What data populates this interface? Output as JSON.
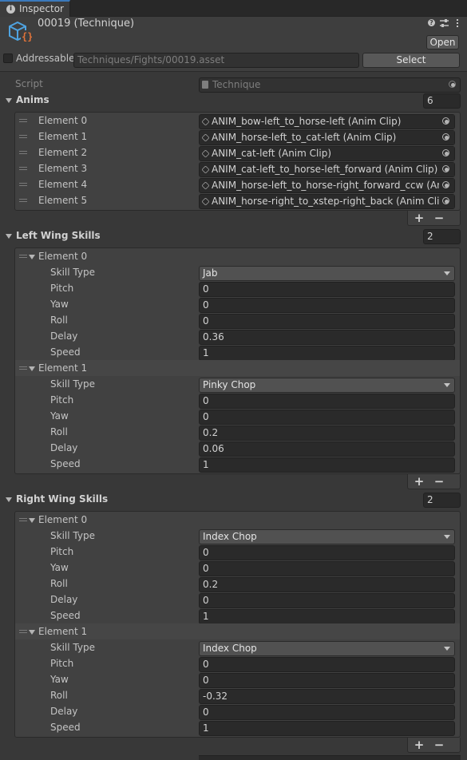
{
  "tab": {
    "label": "Inspector"
  },
  "header": {
    "title": "00019 (Technique)",
    "open_label": "Open",
    "addressable_label": "Addressable",
    "address_path": "Techniques/Fights/00019.asset",
    "select_label": "Select"
  },
  "script": {
    "label": "Script",
    "value": "Technique"
  },
  "anims": {
    "label": "Anims",
    "count": "6",
    "items": [
      {
        "label": "Element 0",
        "value": "ANIM_bow-left_to_horse-left (Anim Clip)"
      },
      {
        "label": "Element 1",
        "value": "ANIM_horse-left_to_cat-left (Anim Clip)"
      },
      {
        "label": "Element 2",
        "value": "ANIM_cat-left (Anim Clip)"
      },
      {
        "label": "Element 3",
        "value": "ANIM_cat-left_to_horse-left_forward (Anim Clip)"
      },
      {
        "label": "Element 4",
        "value": "ANIM_horse-left_to_horse-right_forward_ccw (Anim"
      },
      {
        "label": "Element 5",
        "value": "ANIM_horse-right_to_xstep-right_back (Anim Clip)"
      }
    ]
  },
  "field_labels": {
    "skill_type": "Skill Type",
    "pitch": "Pitch",
    "yaw": "Yaw",
    "roll": "Roll",
    "delay": "Delay",
    "speed": "Speed"
  },
  "left_wing": {
    "label": "Left Wing Skills",
    "count": "2",
    "elements": [
      {
        "label": "Element 0",
        "skill_type": "Jab",
        "pitch": "0",
        "yaw": "0",
        "roll": "0",
        "delay": "0.36",
        "speed": "1"
      },
      {
        "label": "Element 1",
        "skill_type": "Pinky Chop",
        "pitch": "0",
        "yaw": "0",
        "roll": "0.2",
        "delay": "0.06",
        "speed": "1"
      }
    ]
  },
  "right_wing": {
    "label": "Right Wing Skills",
    "count": "2",
    "elements": [
      {
        "label": "Element 0",
        "skill_type": "Index Chop",
        "pitch": "0",
        "yaw": "0",
        "roll": "0.2",
        "delay": "0",
        "speed": "1"
      },
      {
        "label": "Element 1",
        "skill_type": "Index Chop",
        "pitch": "0",
        "yaw": "0",
        "roll": "-0.32",
        "delay": "0",
        "speed": "1"
      }
    ]
  },
  "list_controls": {
    "add": "+",
    "remove": "−"
  },
  "colors": {
    "background": "#383838",
    "field": "#2a2a2a",
    "accent": "#3a79bb",
    "asset_icon": "#4fa3e0",
    "asset_icon_braces": "#e0733a"
  }
}
